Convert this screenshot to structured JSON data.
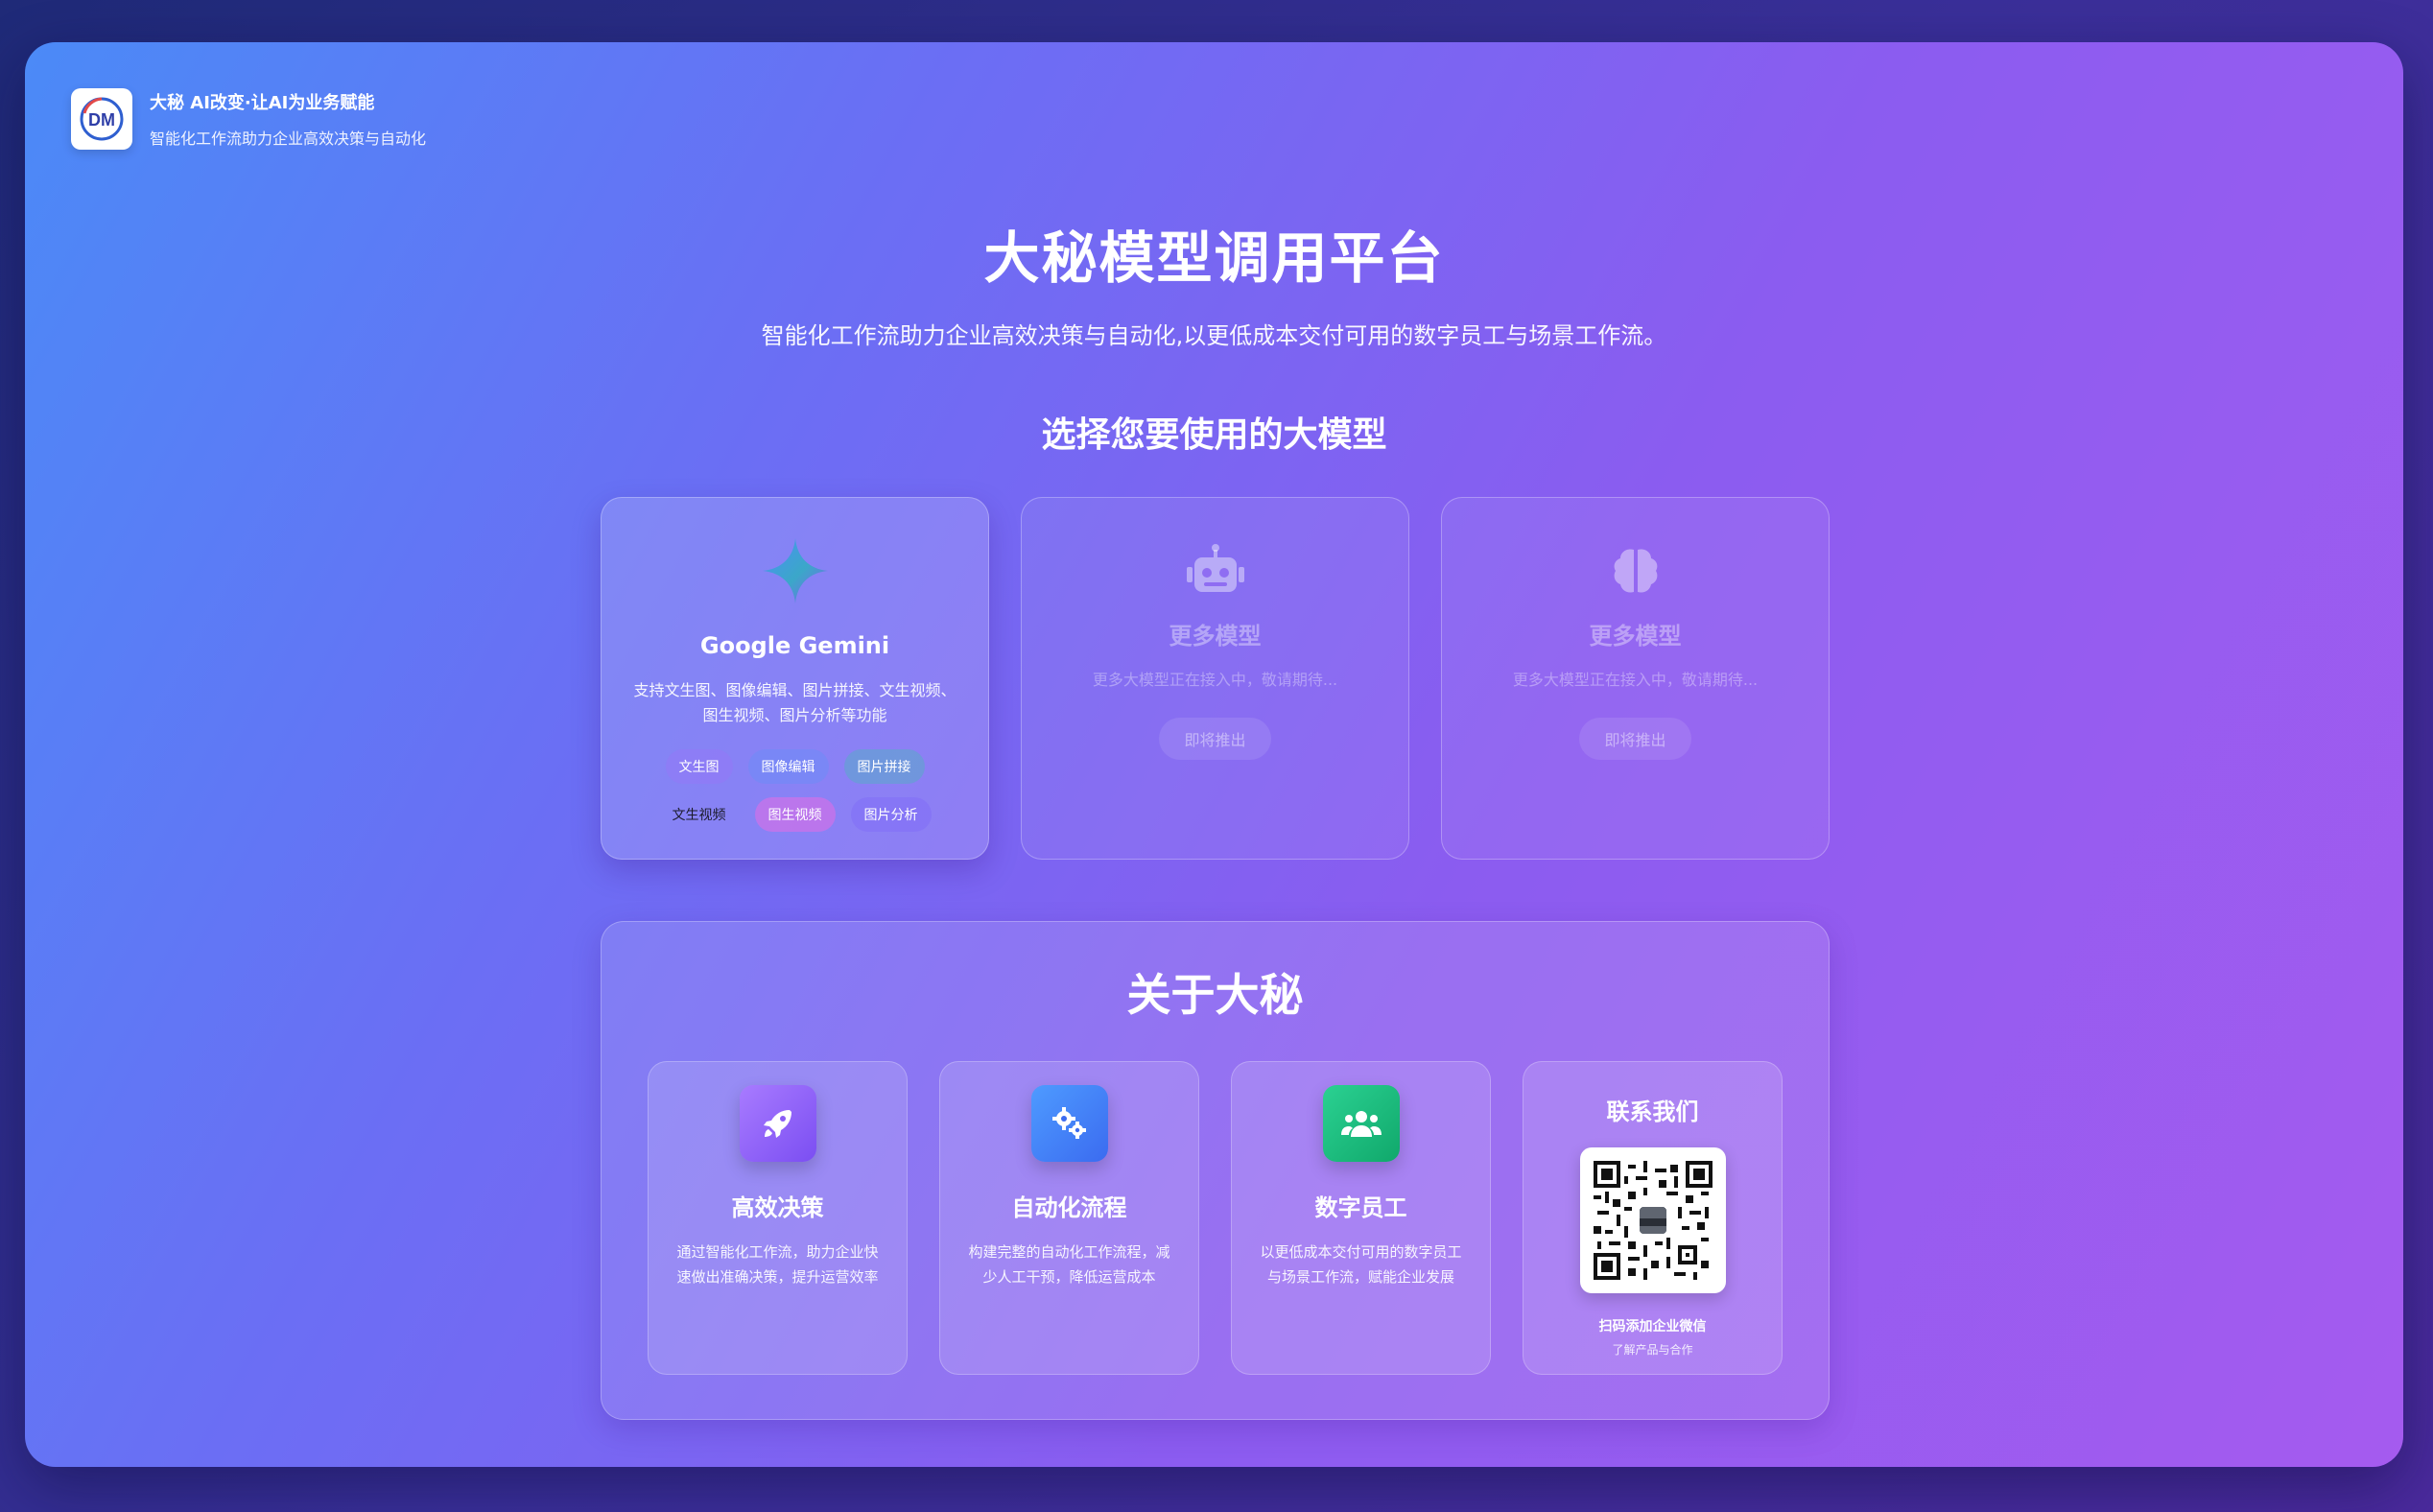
{
  "brand": {
    "logo_text": "DM",
    "title": "大秘 AI改变·让AI为业务赋能",
    "subtitle": "智能化工作流助力企业高效决策与自动化"
  },
  "hero": {
    "title": "大秘模型调用平台",
    "subtitle": "智能化工作流助力企业高效决策与自动化,以更低成本交付可用的数字员工与场景工作流。"
  },
  "models_section": {
    "title": "选择您要使用的大模型",
    "cards": [
      {
        "icon": "sparkle-icon",
        "name": "Google Gemini",
        "description": "支持文生图、图像编辑、图片拼接、文生视频、图生视频、图片分析等功能",
        "tags": [
          "文生图",
          "图像编辑",
          "图片拼接",
          "文生视频",
          "图生视频",
          "图片分析"
        ]
      },
      {
        "icon": "robot-icon",
        "name": "更多模型",
        "description": "更多大模型正在接入中，敬请期待...",
        "status": "即将推出"
      },
      {
        "icon": "brain-icon",
        "name": "更多模型",
        "description": "更多大模型正在接入中，敬请期待...",
        "status": "即将推出"
      }
    ]
  },
  "about": {
    "title": "关于大秘",
    "features": [
      {
        "icon": "rocket-icon",
        "title": "高效决策",
        "description": "通过智能化工作流，助力企业快速做出准确决策，提升运营效率"
      },
      {
        "icon": "gears-icon",
        "title": "自动化流程",
        "description": "构建完整的自动化工作流程，减少人工干预，降低运营成本"
      },
      {
        "icon": "users-icon",
        "title": "数字员工",
        "description": "以更低成本交付可用的数字员工与场景工作流，赋能企业发展"
      }
    ],
    "contact": {
      "title": "联系我们",
      "qr_label": "扫码添加企业微信",
      "qr_sub": "了解产品与合作"
    }
  },
  "colors": {
    "bg_start": "#4b8af7",
    "bg_end": "#a55bef",
    "feature_purple": "#7b4ef2",
    "feature_blue": "#3b6bf0",
    "feature_green": "#10a86b"
  }
}
